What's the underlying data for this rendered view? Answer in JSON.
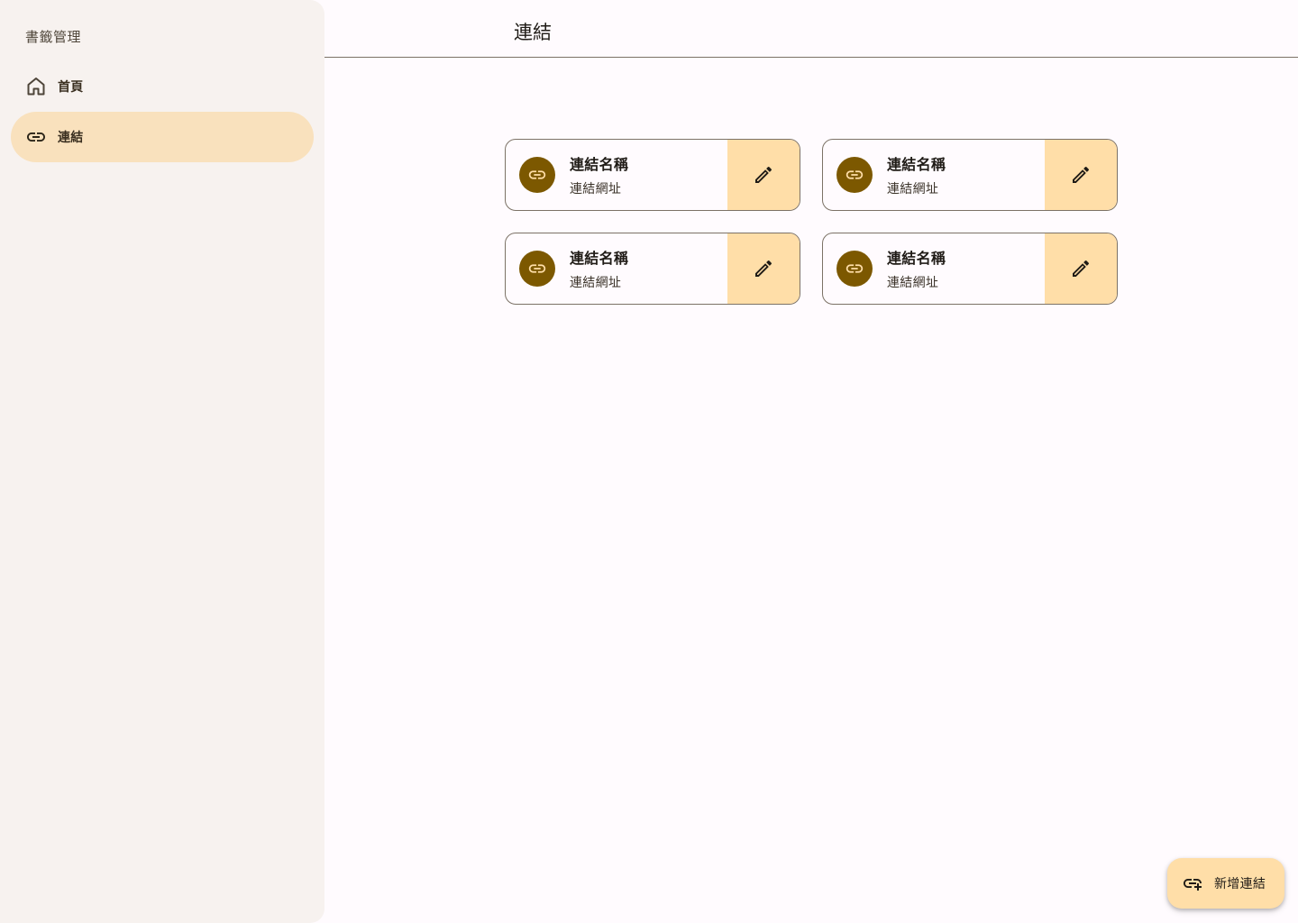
{
  "sidebar": {
    "title": "書籤管理",
    "items": [
      {
        "label": "首頁",
        "icon": "home-icon"
      },
      {
        "label": "連結",
        "icon": "link-icon",
        "active": true
      }
    ]
  },
  "header": {
    "title": "連結"
  },
  "cards": [
    {
      "name": "連結名稱",
      "url": "連結網址"
    },
    {
      "name": "連結名稱",
      "url": "連結網址"
    },
    {
      "name": "連結名稱",
      "url": "連結網址"
    },
    {
      "name": "連結名稱",
      "url": "連結網址"
    }
  ],
  "fab": {
    "label": "新增連結",
    "icon": "add-link-icon"
  },
  "colors": {
    "sidebar_bg": "#f7f2ef",
    "active_nav": "#f9e1bd",
    "accent": "#7c5800",
    "container": "#ffdea8",
    "background": "#fffbfe"
  }
}
